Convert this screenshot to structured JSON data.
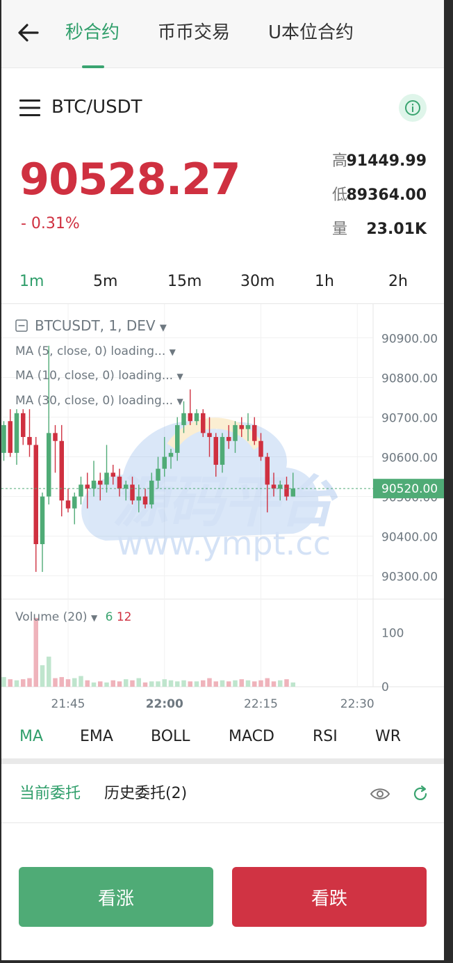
{
  "nav": {
    "tabs": [
      {
        "label": "秒合约",
        "active": true
      },
      {
        "label": "币币交易",
        "active": false
      },
      {
        "label": "U本位合约",
        "active": false
      }
    ]
  },
  "symbol": "BTC/USDT",
  "ticker": {
    "price": "90528.27",
    "change": "- 0.31%",
    "high_label": "高",
    "high": "91449.99",
    "low_label": "低",
    "low": "89364.00",
    "volume_label": "量",
    "volume": "23.01K"
  },
  "intervals": [
    "1m",
    "5m",
    "15m",
    "30m",
    "1h",
    "2h"
  ],
  "chart_legend": {
    "main": "BTCUSDT, 1, DEV",
    "ma5": "MA (5, close, 0) loading...",
    "ma10": "MA (10, close, 0) loading...",
    "ma30": "MA (30, close, 0) loading...",
    "volume": "Volume (20)",
    "vol_up": "6",
    "vol_down": "12"
  },
  "watermark": {
    "title": "源码平台",
    "url": "www.ympt.cc"
  },
  "colors": {
    "up": "#4fab76",
    "down": "#cf3040",
    "accent": "#2f9e6a",
    "vol_up": "#bfe5cd",
    "vol_down": "#efb3bb"
  },
  "chart_data": {
    "type": "candlestick",
    "price_axis": {
      "ticks": [
        "90900.00",
        "90800.00",
        "90700.00",
        "90600.00",
        "90500.00",
        "90400.00",
        "90300.00"
      ],
      "tick_values": [
        90900,
        90800,
        90700,
        90600,
        90500,
        90400,
        90300
      ],
      "ylim": [
        90245,
        90985
      ],
      "last_price_label": "90520.00",
      "last_price": 90520
    },
    "volume_axis": {
      "ticks": [
        "100",
        "0"
      ],
      "tick_values": [
        100,
        0
      ],
      "ylim": [
        0,
        150
      ]
    },
    "time_axis": {
      "labels": [
        "21:45",
        "22:00",
        "22:15",
        "22:30"
      ],
      "label_index": [
        10,
        25,
        40,
        55
      ],
      "bold": [
        "22:00"
      ]
    },
    "candles": [
      {
        "o": 90610,
        "h": 90690,
        "l": 90590,
        "c": 90680
      },
      {
        "o": 90690,
        "h": 90720,
        "l": 90600,
        "c": 90610
      },
      {
        "o": 90610,
        "h": 90720,
        "l": 90580,
        "c": 90710
      },
      {
        "o": 90710,
        "h": 90720,
        "l": 90630,
        "c": 90650
      },
      {
        "o": 90650,
        "h": 90720,
        "l": 90600,
        "c": 90630
      },
      {
        "o": 90630,
        "h": 90650,
        "l": 90310,
        "c": 90380
      },
      {
        "o": 90380,
        "h": 90510,
        "l": 90310,
        "c": 90500
      },
      {
        "o": 90500,
        "h": 90880,
        "l": 90480,
        "c": 90660
      },
      {
        "o": 90660,
        "h": 90680,
        "l": 90560,
        "c": 90640
      },
      {
        "o": 90640,
        "h": 90680,
        "l": 90450,
        "c": 90490
      },
      {
        "o": 90490,
        "h": 90520,
        "l": 90460,
        "c": 90470
      },
      {
        "o": 90470,
        "h": 90510,
        "l": 90430,
        "c": 90500
      },
      {
        "o": 90500,
        "h": 90550,
        "l": 90480,
        "c": 90530
      },
      {
        "o": 90530,
        "h": 90560,
        "l": 90470,
        "c": 90520
      },
      {
        "o": 90520,
        "h": 90590,
        "l": 90500,
        "c": 90540
      },
      {
        "o": 90540,
        "h": 90560,
        "l": 90490,
        "c": 90530
      },
      {
        "o": 90530,
        "h": 90630,
        "l": 90510,
        "c": 90560
      },
      {
        "o": 90560,
        "h": 90580,
        "l": 90530,
        "c": 90550
      },
      {
        "o": 90550,
        "h": 90570,
        "l": 90500,
        "c": 90520
      },
      {
        "o": 90520,
        "h": 90540,
        "l": 90490,
        "c": 90530
      },
      {
        "o": 90530,
        "h": 90550,
        "l": 90480,
        "c": 90490
      },
      {
        "o": 90490,
        "h": 90530,
        "l": 90460,
        "c": 90500
      },
      {
        "o": 90500,
        "h": 90520,
        "l": 90470,
        "c": 90480
      },
      {
        "o": 90480,
        "h": 90560,
        "l": 90470,
        "c": 90540
      },
      {
        "o": 90540,
        "h": 90600,
        "l": 90520,
        "c": 90570
      },
      {
        "o": 90570,
        "h": 90650,
        "l": 90550,
        "c": 90600
      },
      {
        "o": 90600,
        "h": 90620,
        "l": 90570,
        "c": 90610
      },
      {
        "o": 90610,
        "h": 90700,
        "l": 90590,
        "c": 90680
      },
      {
        "o": 90680,
        "h": 90740,
        "l": 90660,
        "c": 90710
      },
      {
        "o": 90710,
        "h": 90770,
        "l": 90680,
        "c": 90690
      },
      {
        "o": 90690,
        "h": 90720,
        "l": 90680,
        "c": 90710
      },
      {
        "o": 90710,
        "h": 90720,
        "l": 90650,
        "c": 90660
      },
      {
        "o": 90660,
        "h": 90700,
        "l": 90600,
        "c": 90650
      },
      {
        "o": 90650,
        "h": 90660,
        "l": 90550,
        "c": 90580
      },
      {
        "o": 90580,
        "h": 90660,
        "l": 90560,
        "c": 90650
      },
      {
        "o": 90650,
        "h": 90680,
        "l": 90620,
        "c": 90640
      },
      {
        "o": 90640,
        "h": 90690,
        "l": 90610,
        "c": 90680
      },
      {
        "o": 90680,
        "h": 90700,
        "l": 90650,
        "c": 90670
      },
      {
        "o": 90670,
        "h": 90710,
        "l": 90640,
        "c": 90680
      },
      {
        "o": 90680,
        "h": 90700,
        "l": 90630,
        "c": 90640
      },
      {
        "o": 90640,
        "h": 90660,
        "l": 90590,
        "c": 90600
      },
      {
        "o": 90600,
        "h": 90610,
        "l": 90460,
        "c": 90530
      },
      {
        "o": 90530,
        "h": 90560,
        "l": 90500,
        "c": 90520
      },
      {
        "o": 90520,
        "h": 90540,
        "l": 90490,
        "c": 90530
      },
      {
        "o": 90530,
        "h": 90550,
        "l": 90490,
        "c": 90500
      },
      {
        "o": 90500,
        "h": 90560,
        "l": 90500,
        "c": 90520
      }
    ],
    "volumes": [
      18,
      14,
      12,
      14,
      16,
      128,
      40,
      56,
      16,
      18,
      14,
      16,
      20,
      12,
      8,
      10,
      8,
      12,
      10,
      14,
      12,
      16,
      8,
      10,
      10,
      14,
      12,
      10,
      12,
      10,
      10,
      12,
      16,
      10,
      12,
      10,
      12,
      14,
      12,
      10,
      12,
      16,
      10,
      12,
      14,
      8
    ]
  },
  "indicators": [
    {
      "label": "MA",
      "active": true
    },
    {
      "label": "EMA",
      "active": false
    },
    {
      "label": "BOLL",
      "active": false
    },
    {
      "label": "MACD",
      "active": false
    },
    {
      "label": "RSI",
      "active": false
    },
    {
      "label": "WR",
      "active": false
    }
  ],
  "orders": {
    "current": "当前委托",
    "history": "历史委托(2)"
  },
  "actions": {
    "up": "看涨",
    "down": "看跌"
  }
}
